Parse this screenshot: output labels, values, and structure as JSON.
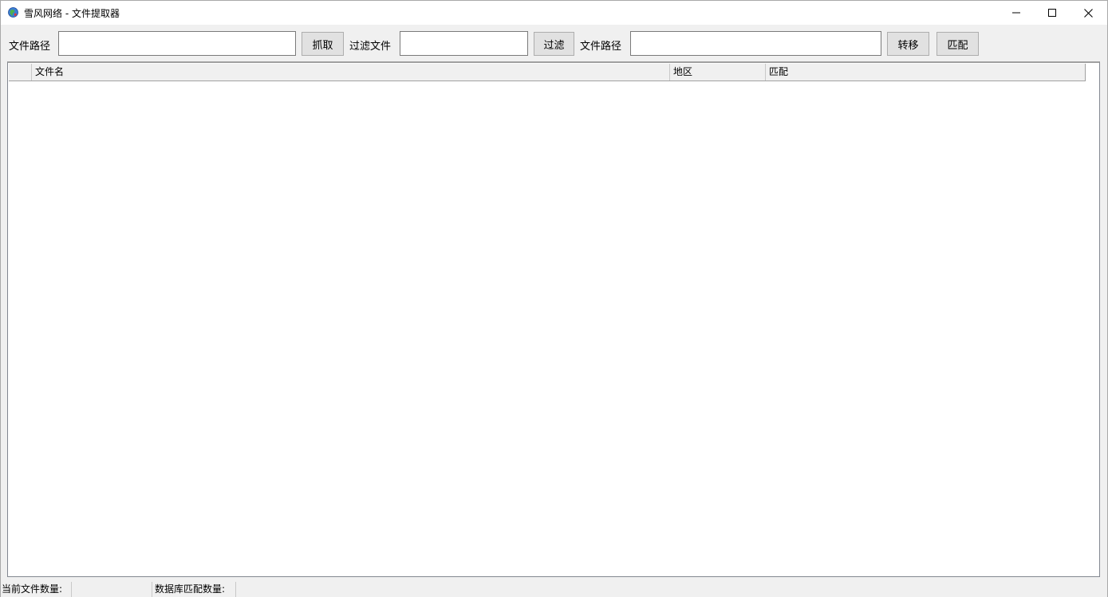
{
  "window": {
    "title": "雪风网络 - 文件提取器",
    "app_icon": "globe-icon",
    "controls": {
      "minimize_icon": "minimize-icon",
      "maximize_icon": "maximize-icon",
      "close_icon": "close-icon"
    }
  },
  "toolbar": {
    "path_label_1": "文件路径",
    "path_input_1": {
      "value": "",
      "placeholder": ""
    },
    "grab_button": "抓取",
    "filter_label": "过滤文件",
    "filter_input": {
      "value": "",
      "placeholder": ""
    },
    "filter_button": "过滤",
    "path_label_2": "文件路径",
    "path_input_2": {
      "value": "",
      "placeholder": ""
    },
    "transfer_button": "转移",
    "match_button": "匹配"
  },
  "grid": {
    "columns": [
      "文件名",
      "地区",
      "匹配"
    ],
    "rows": []
  },
  "statusbar": {
    "current_file_count_label": "当前文件数量:",
    "current_file_count_value": "",
    "db_match_count_label": "数据库匹配数量:",
    "db_match_count_value": ""
  },
  "colors": {
    "window_bg": "#f0f0f0",
    "titlebar_bg": "#ffffff",
    "button_bg": "#e1e1e1",
    "button_border": "#adadad",
    "grid_bg": "#ffffff",
    "header_bg": "#f0f0f0"
  }
}
